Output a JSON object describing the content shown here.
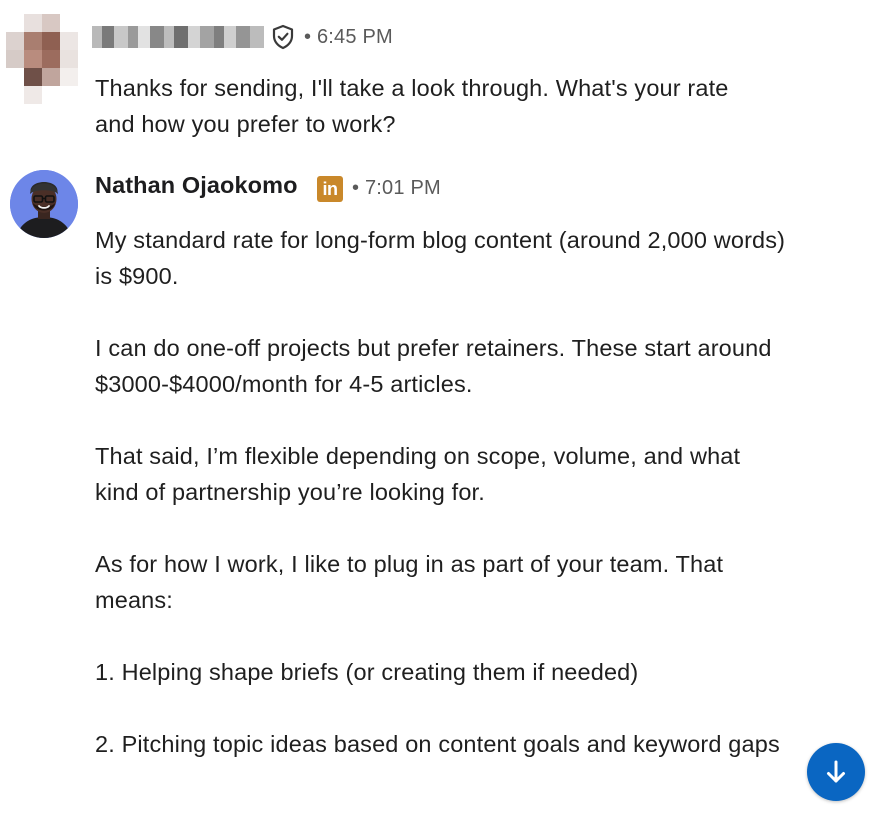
{
  "message_1": {
    "sender_name_redacted": true,
    "verified_icon": "shield-check-icon",
    "time": "• 6:45 PM",
    "text": "Thanks for sending, I'll take a look through. What's your rate and how you prefer to work?"
  },
  "message_2": {
    "sender_name": "Nathan Ojaokomo",
    "badge_icon": "linkedin-icon",
    "badge_label": "in",
    "badge_color": "#c9882a",
    "time": "• 7:01 PM",
    "paragraphs": [
      "My standard rate for long-form blog content (around 2,000 words) is $900.",
      "I can do one-off projects but prefer retainers. These start around $3000-$4000/month for 4-5 articles.",
      "That said, I’m flexible depending on scope, volume, and what kind of partnership you’re looking for.",
      "As for how I work, I like to plug in as part of your team. That means:",
      "1. Helping shape briefs (or creating them if needed)",
      "2. Pitching topic ideas based on content goals and keyword gaps"
    ]
  },
  "scroll_button": {
    "icon": "arrow-down-icon",
    "color": "#0a66c2"
  }
}
